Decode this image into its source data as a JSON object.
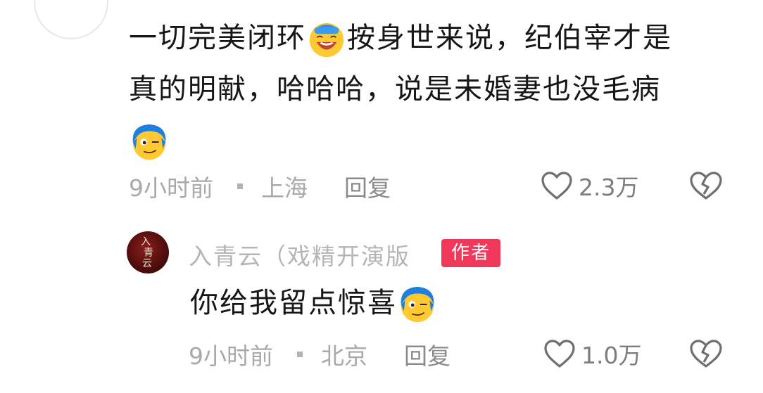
{
  "comment": {
    "text_line1": "一切完美闭环",
    "text_line1_cont": "按身世来说，纪伯宰才是",
    "text_line2": "真的明献，哈哈哈，说是未婚妻也没毛病",
    "emoji_1": "facepalm-laughing-emoji",
    "emoji_2": "blue-hair-smirk-emoji",
    "time": "9小时前",
    "location": "上海",
    "reply_label": "回复",
    "like_count": "2.3万"
  },
  "reply": {
    "author_name": "入青云（戏精开演版",
    "author_badge": "作者",
    "avatar_glyphs": [
      "入",
      "青",
      "云"
    ],
    "text": "你给我留点惊喜",
    "emoji": "blue-hair-smirk-emoji",
    "time": "9小时前",
    "location": "北京",
    "reply_label": "回复",
    "like_count": "1.0万"
  },
  "colors": {
    "badge": "#f0395a",
    "meta_text": "#a9a9a9",
    "body_text": "#161616"
  }
}
